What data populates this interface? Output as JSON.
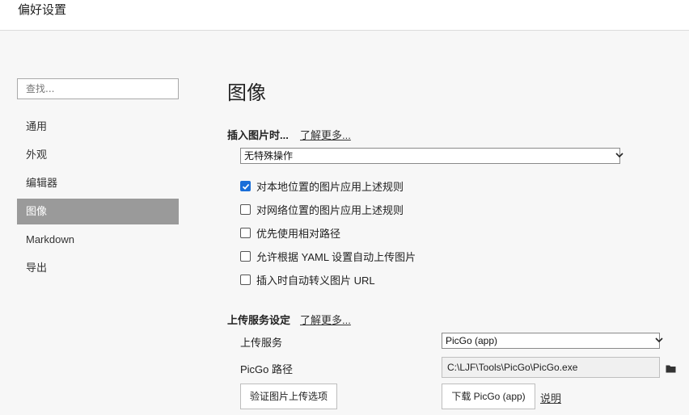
{
  "window": {
    "title": "偏好设置"
  },
  "search": {
    "placeholder": "查找..."
  },
  "sidebar": {
    "items": [
      {
        "label": "通用"
      },
      {
        "label": "外观"
      },
      {
        "label": "编辑器"
      },
      {
        "label": "图像",
        "active": true
      },
      {
        "label": "Markdown"
      },
      {
        "label": "导出"
      }
    ]
  },
  "main": {
    "title": "图像",
    "insert": {
      "label": "插入图片时...",
      "learn_more": "了解更多...",
      "select_value": "无特殊操作",
      "options": [
        {
          "label": "对本地位置的图片应用上述规则",
          "checked": true
        },
        {
          "label": "对网络位置的图片应用上述规则",
          "checked": false
        },
        {
          "label": "优先使用相对路径",
          "checked": false
        },
        {
          "label": "允许根据 YAML 设置自动上传图片",
          "checked": false
        },
        {
          "label": "插入时自动转义图片 URL",
          "checked": false
        }
      ]
    },
    "upload": {
      "label": "上传服务设定",
      "learn_more": "了解更多...",
      "service_label": "上传服务",
      "service_value": "PicGo (app)",
      "path_label": "PicGo 路径",
      "path_value": "C:\\LJF\\Tools\\PicGo\\PicGo.exe",
      "verify_button": "验证图片上传选项",
      "download_button": "下载 PicGo (app)",
      "help_link": "说明"
    }
  },
  "colors": {
    "accent": "#1a6ed8",
    "active_nav": "#9a9a9a"
  }
}
